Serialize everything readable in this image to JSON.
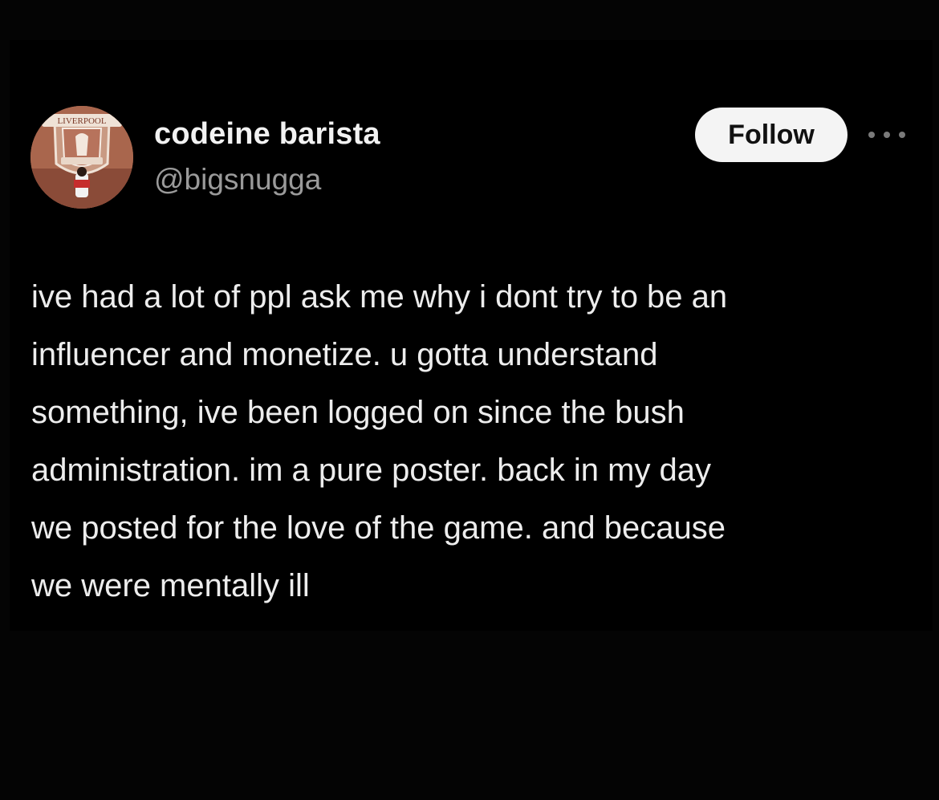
{
  "author": {
    "display_name": "codeine barista",
    "handle": "@bigsnugga",
    "avatar_icon": "liverpool-crest-avatar",
    "avatar_text": "LIVERPOOL"
  },
  "actions": {
    "follow_label": "Follow",
    "more_icon": "ellipsis-icon"
  },
  "post": {
    "lines": [
      "ive had a lot of ppl ask me why i dont try to be an",
      "influencer and monetize. u gotta understand",
      "something, ive been logged on since the bush",
      "administration. im a pure poster. back in my day",
      "we posted for the love of the game. and because",
      "we were mentally ill"
    ]
  },
  "colors": {
    "background": "#040404",
    "text_primary": "#ededed",
    "text_secondary": "#9a9a9a",
    "button_bg": "#f4f4f4",
    "button_text": "#111111"
  }
}
